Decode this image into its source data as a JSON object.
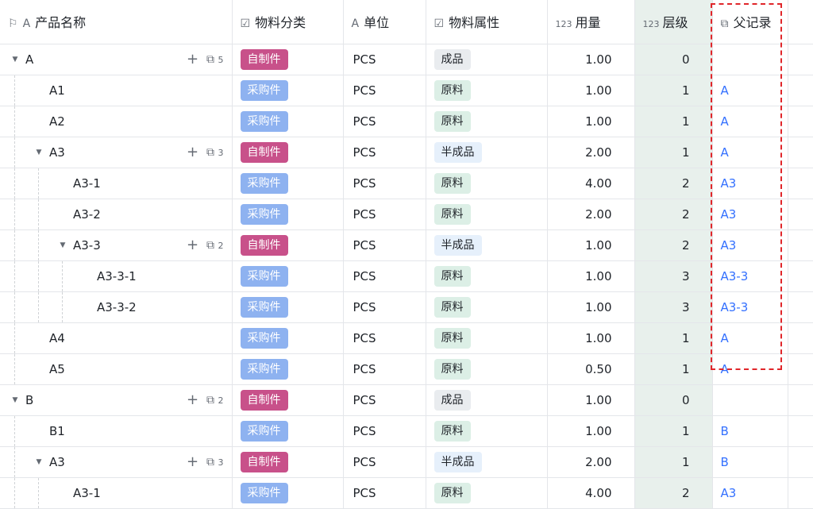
{
  "headers": {
    "name": "产品名称",
    "name_icon_a": "A",
    "category": "物料分类",
    "unit_icon": "A",
    "unit": "单位",
    "attribute": "物料属性",
    "qty_icon": "123",
    "quantity": "用量",
    "level_icon": "123",
    "level": "层级",
    "parent": "父记录"
  },
  "rows": [
    {
      "name": "A",
      "cat": "自制件",
      "unit": "PCS",
      "attr": "成品",
      "qty": "1.00",
      "level": "0",
      "parent": "",
      "children": "5"
    },
    {
      "name": "A1",
      "cat": "采购件",
      "unit": "PCS",
      "attr": "原料",
      "qty": "1.00",
      "level": "1",
      "parent": "A"
    },
    {
      "name": "A2",
      "cat": "采购件",
      "unit": "PCS",
      "attr": "原料",
      "qty": "1.00",
      "level": "1",
      "parent": "A"
    },
    {
      "name": "A3",
      "cat": "自制件",
      "unit": "PCS",
      "attr": "半成品",
      "qty": "2.00",
      "level": "1",
      "parent": "A",
      "children": "3"
    },
    {
      "name": "A3-1",
      "cat": "采购件",
      "unit": "PCS",
      "attr": "原料",
      "qty": "4.00",
      "level": "2",
      "parent": "A3"
    },
    {
      "name": "A3-2",
      "cat": "采购件",
      "unit": "PCS",
      "attr": "原料",
      "qty": "2.00",
      "level": "2",
      "parent": "A3"
    },
    {
      "name": "A3-3",
      "cat": "自制件",
      "unit": "PCS",
      "attr": "半成品",
      "qty": "1.00",
      "level": "2",
      "parent": "A3",
      "children": "2"
    },
    {
      "name": "A3-3-1",
      "cat": "采购件",
      "unit": "PCS",
      "attr": "原料",
      "qty": "1.00",
      "level": "3",
      "parent": "A3-3"
    },
    {
      "name": "A3-3-2",
      "cat": "采购件",
      "unit": "PCS",
      "attr": "原料",
      "qty": "1.00",
      "level": "3",
      "parent": "A3-3"
    },
    {
      "name": "A4",
      "cat": "采购件",
      "unit": "PCS",
      "attr": "原料",
      "qty": "1.00",
      "level": "1",
      "parent": "A"
    },
    {
      "name": "A5",
      "cat": "采购件",
      "unit": "PCS",
      "attr": "原料",
      "qty": "0.50",
      "level": "1",
      "parent": "A"
    },
    {
      "name": "B",
      "cat": "自制件",
      "unit": "PCS",
      "attr": "成品",
      "qty": "1.00",
      "level": "0",
      "parent": "",
      "children": "2"
    },
    {
      "name": "B1",
      "cat": "采购件",
      "unit": "PCS",
      "attr": "原料",
      "qty": "1.00",
      "level": "1",
      "parent": "B"
    },
    {
      "name": "A3",
      "cat": "自制件",
      "unit": "PCS",
      "attr": "半成品",
      "qty": "2.00",
      "level": "1",
      "parent": "B",
      "children": "3"
    },
    {
      "name": "A3-1",
      "cat": "采购件",
      "unit": "PCS",
      "attr": "原料",
      "qty": "4.00",
      "level": "2",
      "parent": "A3"
    }
  ],
  "colors": {
    "self_made_tag": "#c8518a",
    "purchased_tag": "#8eb2f0",
    "level_column_bg": "#e8f0ec",
    "parent_link": "#3370ff",
    "highlight": "#e0262a"
  }
}
